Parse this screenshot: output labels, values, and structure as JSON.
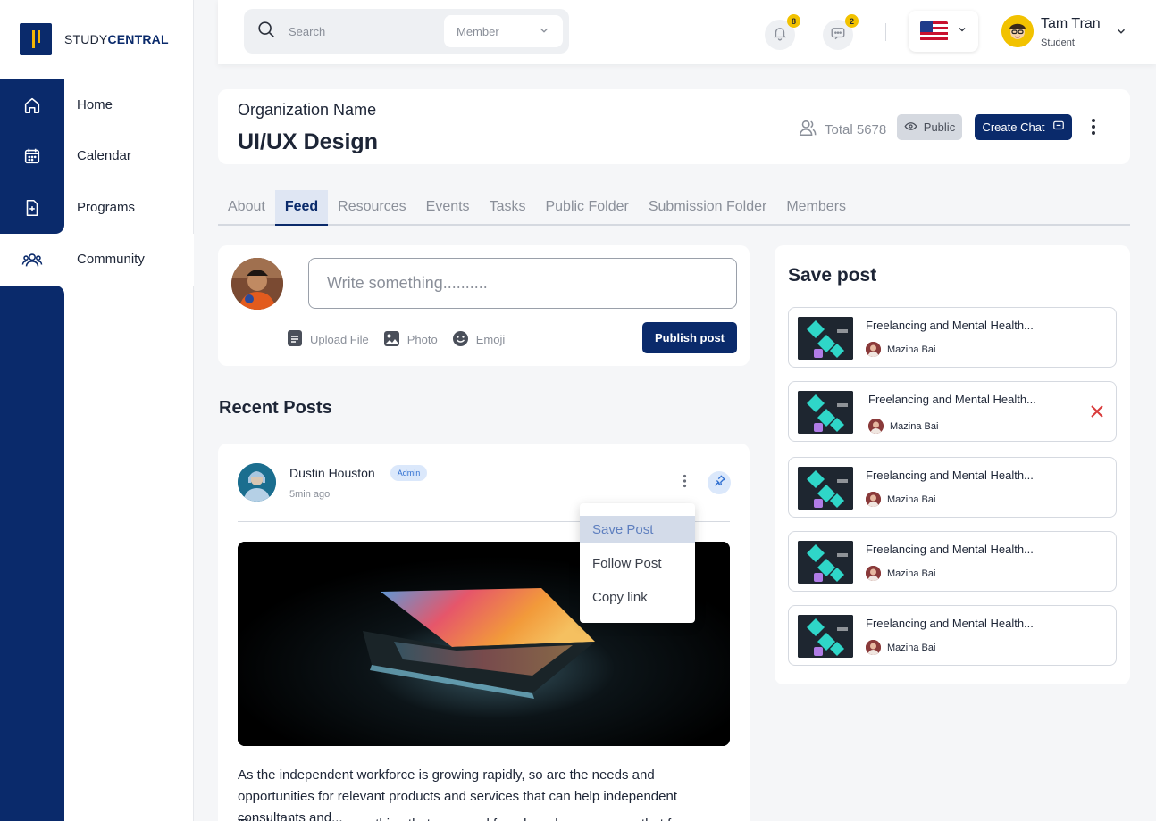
{
  "brand": {
    "prefix": "STUDY",
    "suffix": "CENTRAL"
  },
  "nav": [
    {
      "label": "Home",
      "icon": "home-icon"
    },
    {
      "label": "Calendar",
      "icon": "calendar-icon"
    },
    {
      "label": "Programs",
      "icon": "programs-icon"
    },
    {
      "label": "Community",
      "icon": "community-icon",
      "active": true
    }
  ],
  "topbar": {
    "search_placeholder": "Search",
    "member_select": "Member",
    "notifications_count": "8",
    "messages_count": "2",
    "language_flag": "us-flag",
    "user": {
      "name": "Tam Tran",
      "role": "Student"
    }
  },
  "org": {
    "name": "Organization Name",
    "title": "UI/UX Design",
    "total": "Total 5678",
    "visibility": "Public",
    "create_chat": "Create Chat"
  },
  "tabs": [
    {
      "label": "About"
    },
    {
      "label": "Feed",
      "active": true
    },
    {
      "label": "Resources"
    },
    {
      "label": "Events"
    },
    {
      "label": "Tasks"
    },
    {
      "label": "Public Folder"
    },
    {
      "label": "Submission Folder"
    },
    {
      "label": "Members"
    }
  ],
  "composer": {
    "placeholder": "Write something..........",
    "upload": "Upload File",
    "photo": "Photo",
    "emoji": "Emoji",
    "publish": "Publish post"
  },
  "recent_posts_title": "Recent Posts",
  "post": {
    "author": "Dustin Houston",
    "badge": "Admin",
    "time": "5min ago",
    "text": "As the independent workforce is growing rapidly, so are the needs and opportunities for relevant products and services that can help independent consultants and...",
    "text_2": "This book covers everything that you need for a broad range career that focus on creating and"
  },
  "post_menu": [
    "Save Post",
    "Follow Post",
    "Copy link"
  ],
  "save_panel": {
    "title": "Save post",
    "items": [
      {
        "title": "Freelancing and Mental Health...",
        "author": "Mazina Bai"
      },
      {
        "title": "Freelancing and Mental Health...",
        "author": "Mazina Bai",
        "removable": true
      },
      {
        "title": "Freelancing and Mental Health...",
        "author": "Mazina Bai"
      },
      {
        "title": "Freelancing and Mental Health...",
        "author": "Mazina Bai"
      },
      {
        "title": "Freelancing and Mental Health...",
        "author": "Mazina Bai"
      }
    ]
  },
  "colors": {
    "brand_navy": "#0a2a6b",
    "accent_yellow": "#f2c200",
    "close_red": "#d93a3a"
  }
}
